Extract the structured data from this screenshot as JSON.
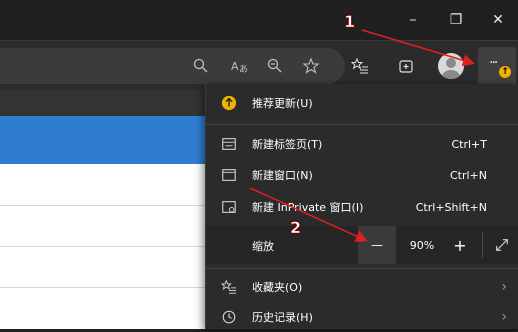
{
  "window": {
    "minimize_glyph": "–",
    "restore_glyph": "❐",
    "close_glyph": "✕"
  },
  "toolbar": {
    "icons": [
      "zoom-icon",
      "read-aloud-icon",
      "zoom-out-icon",
      "favorite-star-icon",
      "favorites-list-icon",
      "collections-icon",
      "profile-avatar-icon",
      "more-icon"
    ],
    "more_label": "···"
  },
  "menu": {
    "update": "推荐更新(U)",
    "new_tab": "新建标签页(T)",
    "new_tab_shortcut": "Ctrl+T",
    "new_window": "新建窗口(N)",
    "new_window_shortcut": "Ctrl+N",
    "new_inprivate": "新建 InPrivate 窗口(I)",
    "new_inprivate_shortcut": "Ctrl+Shift+N",
    "zoom_label": "缩放",
    "zoom_minus": "—",
    "zoom_value": "90%",
    "zoom_plus": "+",
    "favorites": "收藏夹(O)",
    "history": "历史记录(H)"
  },
  "annotations": {
    "step1": "1",
    "step2": "2"
  },
  "colors": {
    "accent_update": "#f2b200",
    "annotation_arrow": "#e02020"
  }
}
